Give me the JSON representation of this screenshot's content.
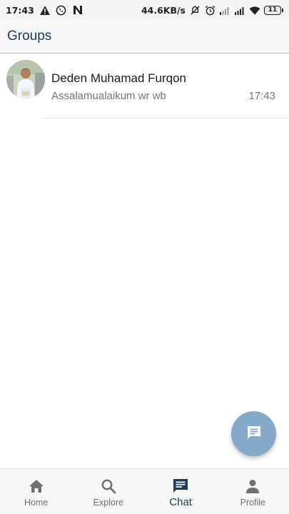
{
  "status_bar": {
    "time": "17:43",
    "left_icons": [
      "warning-icon",
      "whatsapp-icon",
      "n-app-icon"
    ],
    "network_speed": "44.6KB/s",
    "right_icons": [
      "vibrate-off-icon",
      "alarm-icon",
      "signal-icon",
      "signal-icon",
      "wifi-icon"
    ],
    "battery_level": "11"
  },
  "header": {
    "title": "Groups"
  },
  "chats": [
    {
      "name": "Deden Muhamad Furqon",
      "last_message": "Assalamualaikum wr wb",
      "time": "17:43"
    }
  ],
  "fab": {
    "icon": "new-chat-icon",
    "color": "#85a9c8"
  },
  "bottom_nav": {
    "items": [
      {
        "label": "Home",
        "icon": "home-icon",
        "active": false
      },
      {
        "label": "Explore",
        "icon": "search-icon",
        "active": false
      },
      {
        "label": "Chat",
        "icon": "chat-icon",
        "active": true
      },
      {
        "label": "Profile",
        "icon": "person-icon",
        "active": false
      }
    ]
  },
  "colors": {
    "accent": "#1b3a5c",
    "inactive": "#6f6f6f",
    "fab": "#85a9c8"
  }
}
